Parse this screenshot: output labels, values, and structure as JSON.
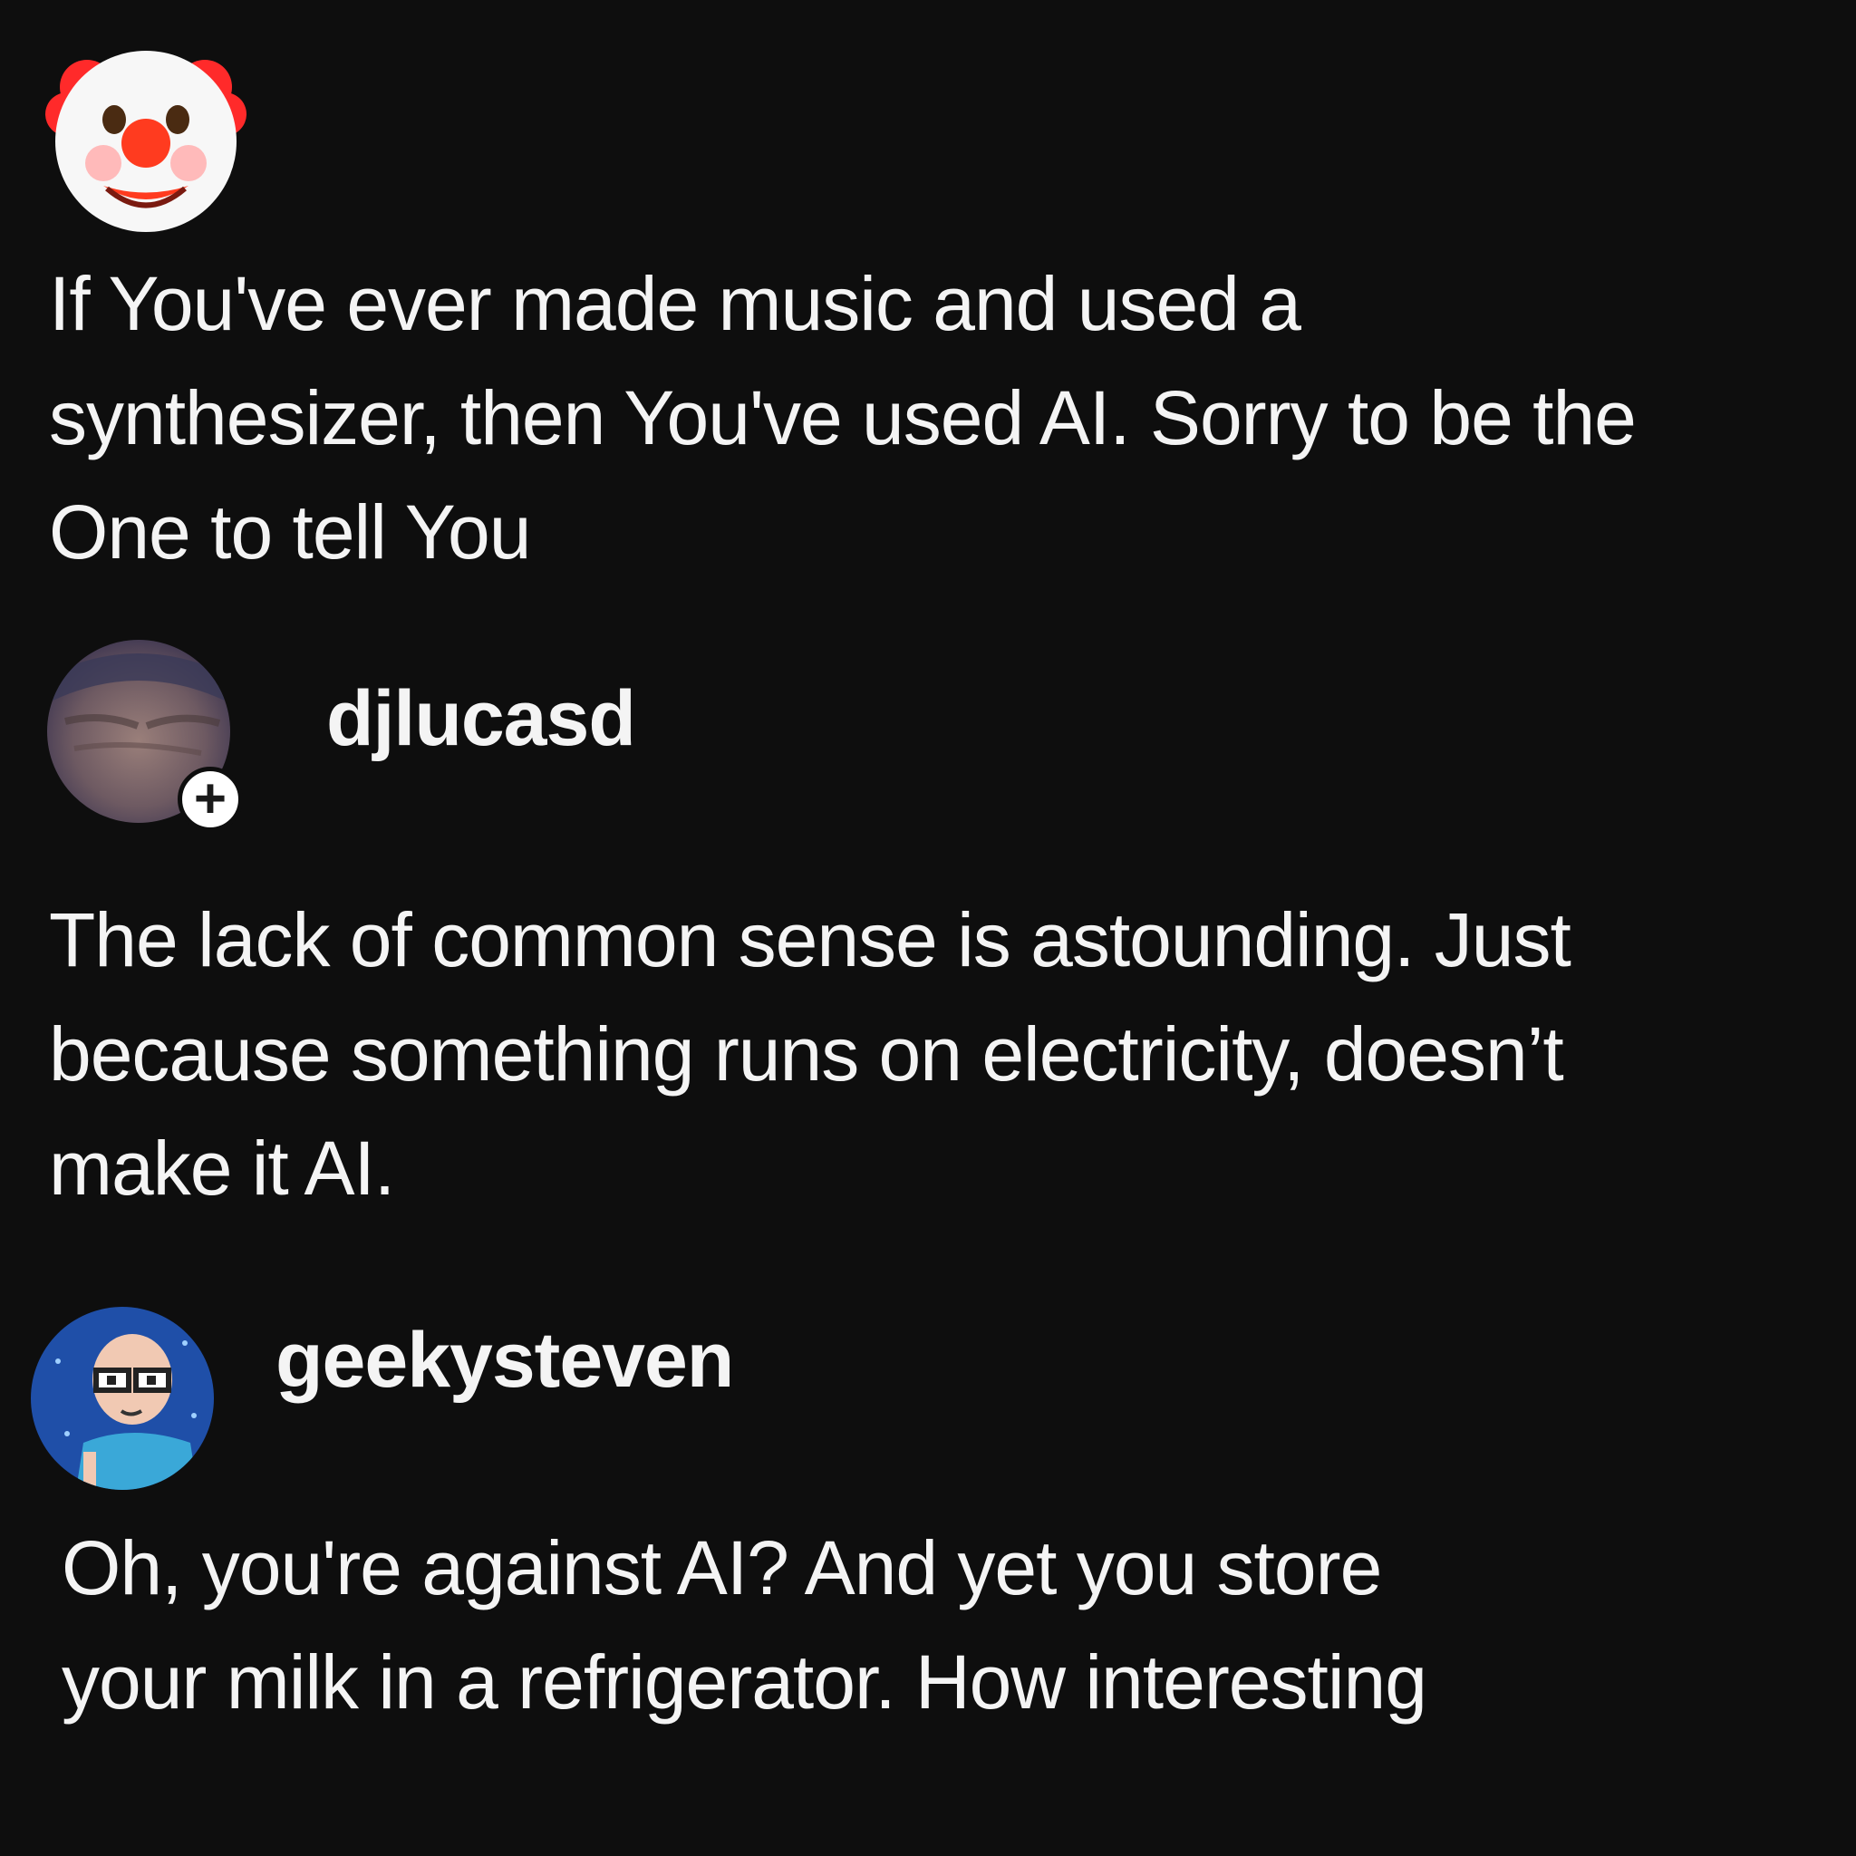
{
  "comments": [
    {
      "avatar": "clown-face-emoji",
      "username": "",
      "text": "If You've ever made music and used a\nsynthesizer, then You've used AI. Sorry to be the\nOne to tell You"
    },
    {
      "avatar": "user-photo-avatar",
      "username": "djlucasd",
      "follow_badge": "+",
      "text": "The lack of common sense is astounding. Just\nbecause something runs on electricity, doesn’t\nmake it AI."
    },
    {
      "avatar": "pixel-art-avatar",
      "username": "geekysteven",
      "text": "Oh, you're against AI? And yet you store\nyour milk in a refrigerator. How interesting"
    }
  ],
  "colors": {
    "background": "#0e0e0e",
    "text": "#f4f4f4",
    "pixel_avatar_bg": "#1f4fa8",
    "pixel_avatar_shirt": "#3aa8d8",
    "clown_nose": "#ff3b1f",
    "clown_hair": "#ff2a2a"
  }
}
